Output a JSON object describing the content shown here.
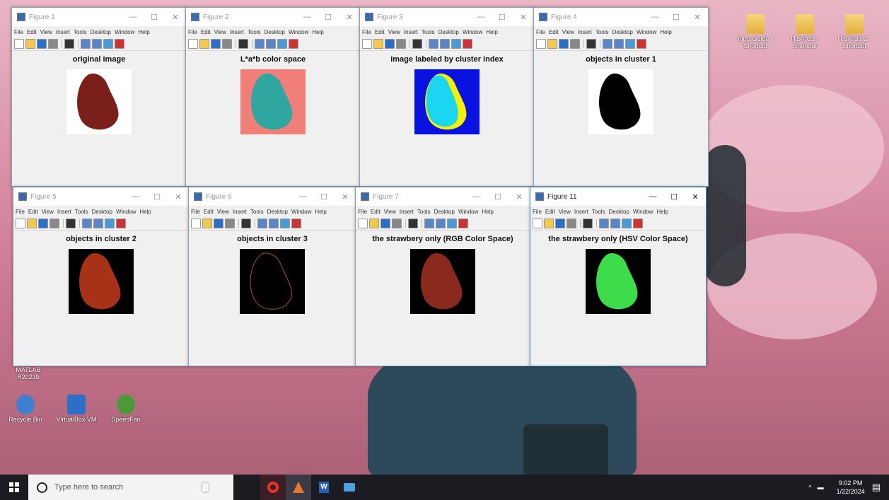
{
  "desktop": {
    "icons_right": [
      {
        "label": "Intro Guide - Shortcut",
        "icon": "folder-icon"
      },
      {
        "label": "ITS4033 - Shortcut",
        "icon": "folder-icon"
      },
      {
        "label": "ITS4033 2 - Shortcut",
        "icon": "folder-icon"
      }
    ],
    "icons_left": [
      {
        "label": "MATLAB R2023b",
        "icon": "matlab-icon"
      },
      {
        "label": "Recycle Bin",
        "icon": "network-icon"
      },
      {
        "label": "VirtualBox VM",
        "icon": "box-icon"
      },
      {
        "label": "SpeedFan",
        "icon": "fan-icon"
      }
    ]
  },
  "menu": [
    "File",
    "Edit",
    "View",
    "Insert",
    "Tools",
    "Desktop",
    "Window",
    "Help"
  ],
  "figures": [
    {
      "title": "Figure 1",
      "plot_title": "original image",
      "image": "strawberry-original"
    },
    {
      "title": "Figure 2",
      "plot_title": "L*a*b color space",
      "image": "lab"
    },
    {
      "title": "Figure 3",
      "plot_title": "image labeled by cluster index",
      "image": "cluster-index"
    },
    {
      "title": "Figure 4",
      "plot_title": "objects in cluster 1",
      "image": "cluster1"
    },
    {
      "title": "Figure 5",
      "plot_title": "objects in cluster 2",
      "image": "cluster2"
    },
    {
      "title": "Figure 6",
      "plot_title": "objects in cluster 3",
      "image": "cluster3"
    },
    {
      "title": "Figure 7",
      "plot_title": "the strawbery only (RGB Color Space)",
      "image": "rgb-only"
    },
    {
      "title": "Figure 11",
      "plot_title": "the strawbery only (HSV Color Space)",
      "image": "hsv-only"
    }
  ],
  "window_buttons": {
    "minimize": "—",
    "maximize": "☐",
    "close": "✕"
  },
  "taskbar": {
    "search_placeholder": "Type here to search",
    "time": "9:02 PM",
    "date": "1/22/2024"
  }
}
